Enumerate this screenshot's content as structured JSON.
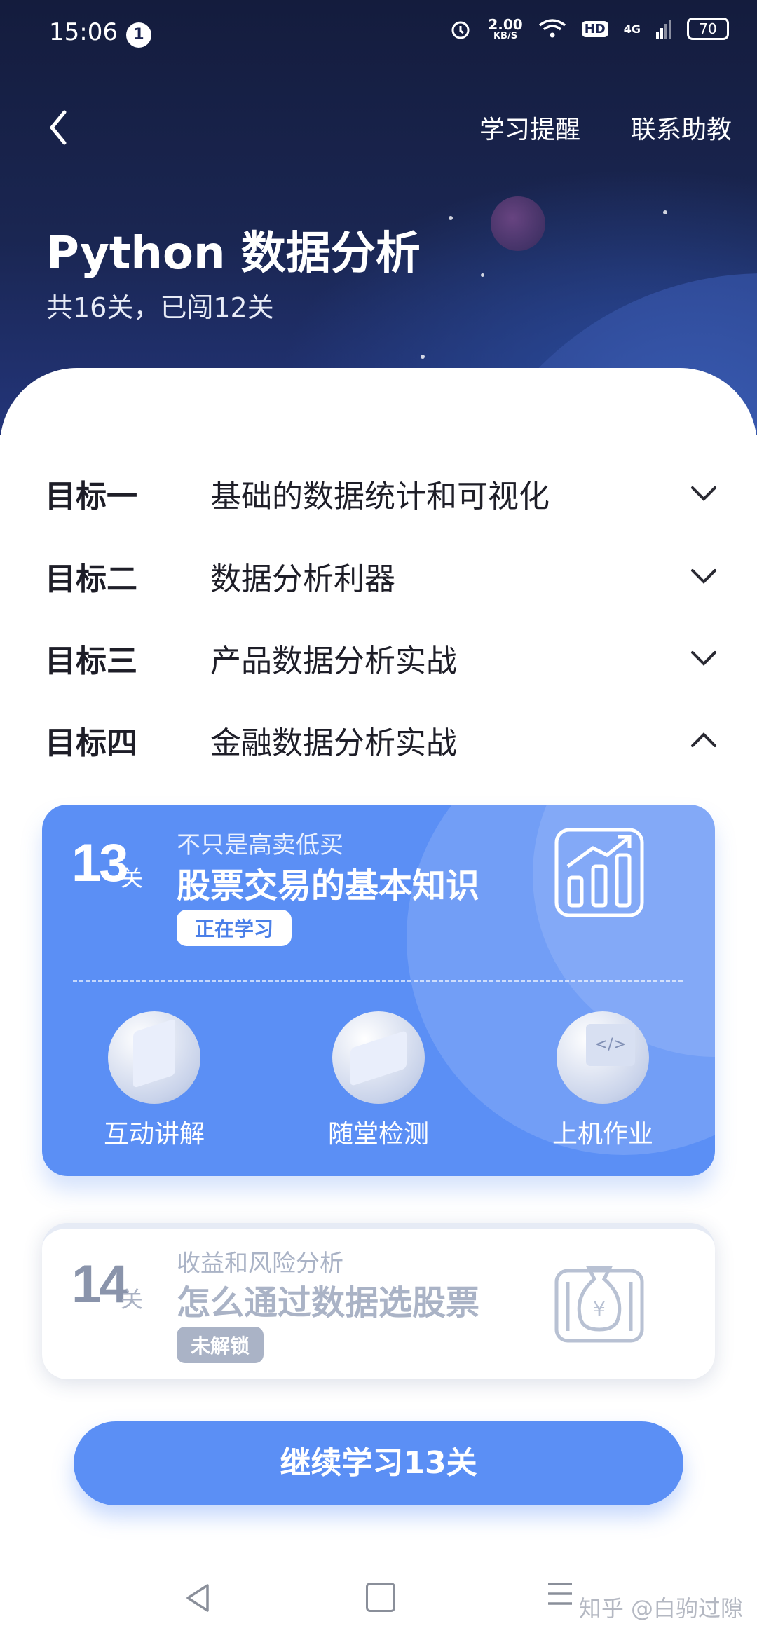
{
  "status_bar": {
    "time": "15:06",
    "notification_count": "1",
    "net_speed": "2.00",
    "net_speed_unit": "KB/S",
    "hd": "HD",
    "signal": "4G",
    "battery": "70"
  },
  "header": {
    "reminder": "学习提醒",
    "contact": "联系助教",
    "title": "Python 数据分析",
    "subtitle": "共16关，已闯12关"
  },
  "goals": [
    {
      "key": "目标一",
      "value": "基础的数据统计和可视化",
      "state": "collapsed"
    },
    {
      "key": "目标二",
      "value": "数据分析利器",
      "state": "collapsed"
    },
    {
      "key": "目标三",
      "value": "产品数据分析实战",
      "state": "collapsed"
    },
    {
      "key": "目标四",
      "value": "金融数据分析实战",
      "state": "expanded"
    }
  ],
  "lesson_current": {
    "number": "13",
    "unit": "关",
    "subtitle": "不只是高卖低买",
    "title": "股票交易的基本知识",
    "status": "正在学习",
    "icon": "bar-chart-icon",
    "activities": [
      "互动讲解",
      "随堂检测",
      "上机作业"
    ]
  },
  "lesson_locked": {
    "number": "14",
    "unit": "关",
    "subtitle": "收益和风险分析",
    "title": "怎么通过数据选股票",
    "status": "未解锁",
    "icon": "money-bag-icon"
  },
  "cta": {
    "label": "继续学习13关"
  },
  "footer": {
    "watermark": "知乎 @白驹过隙"
  },
  "colors": {
    "accent": "#5b8ff5",
    "hero": "#1a2652"
  }
}
